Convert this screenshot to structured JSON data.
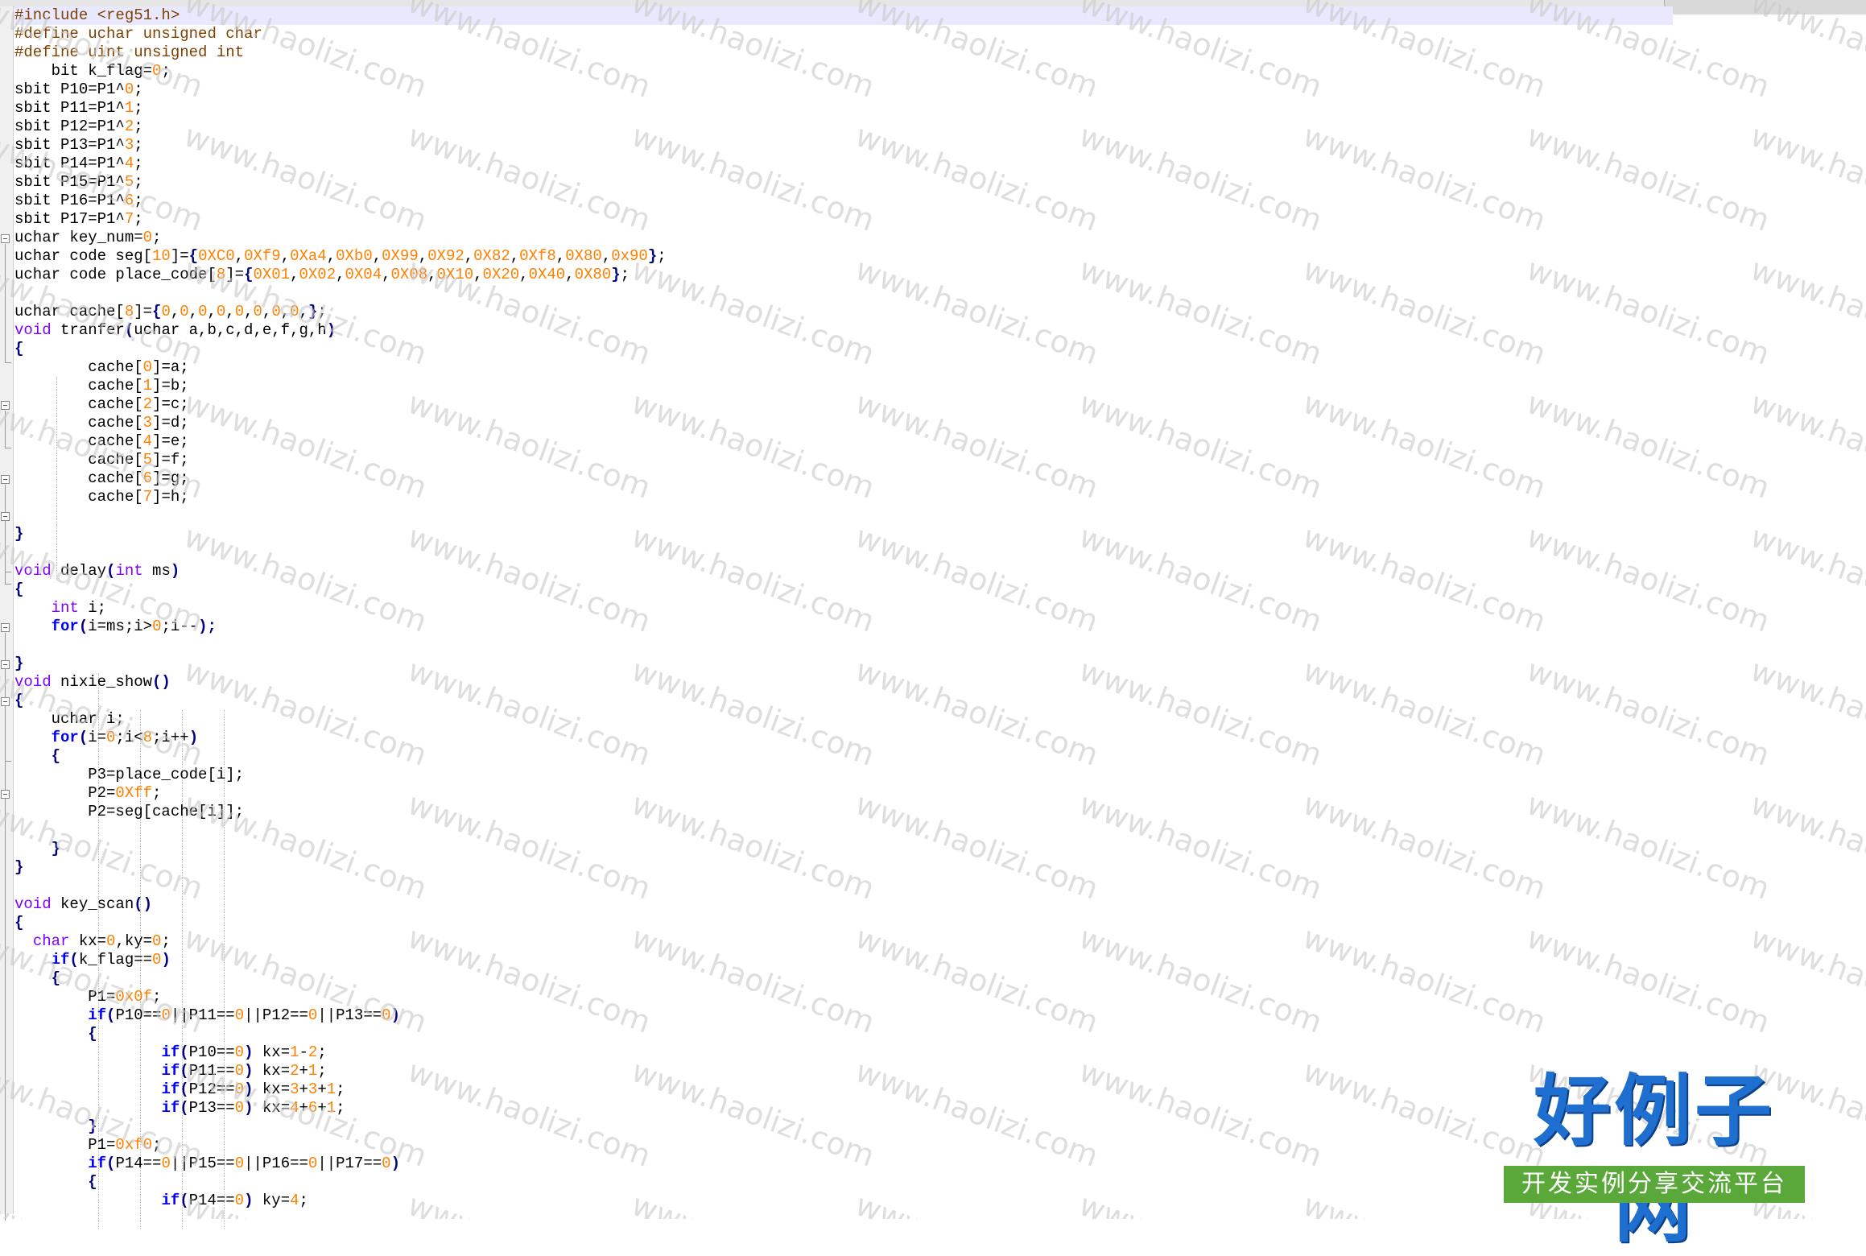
{
  "editor": {
    "lines": [
      [
        {
          "t": "#include <reg51.h>",
          "c": "pre"
        }
      ],
      [
        {
          "t": "#define uchar unsigned char",
          "c": "pre"
        }
      ],
      [
        {
          "t": "#define uint unsigned int",
          "c": "pre"
        }
      ],
      [
        {
          "t": "    bit k_flag="
        },
        {
          "t": "0",
          "c": "num"
        },
        {
          "t": ";"
        }
      ],
      [
        {
          "t": "sbit P10=P1^"
        },
        {
          "t": "0",
          "c": "num"
        },
        {
          "t": ";"
        }
      ],
      [
        {
          "t": "sbit P11=P1^"
        },
        {
          "t": "1",
          "c": "num"
        },
        {
          "t": ";"
        }
      ],
      [
        {
          "t": "sbit P12=P1^"
        },
        {
          "t": "2",
          "c": "num"
        },
        {
          "t": ";"
        }
      ],
      [
        {
          "t": "sbit P13=P1^"
        },
        {
          "t": "3",
          "c": "num"
        },
        {
          "t": ";"
        }
      ],
      [
        {
          "t": "sbit P14=P1^"
        },
        {
          "t": "4",
          "c": "num"
        },
        {
          "t": ";"
        }
      ],
      [
        {
          "t": "sbit P15=P1^"
        },
        {
          "t": "5",
          "c": "num"
        },
        {
          "t": ";"
        }
      ],
      [
        {
          "t": "sbit P16=P1^"
        },
        {
          "t": "6",
          "c": "num"
        },
        {
          "t": ";"
        }
      ],
      [
        {
          "t": "sbit P17=P1^"
        },
        {
          "t": "7",
          "c": "num"
        },
        {
          "t": ";"
        }
      ],
      [
        {
          "t": "uchar key_num="
        },
        {
          "t": "0",
          "c": "num"
        },
        {
          "t": ";"
        }
      ],
      [
        {
          "t": "uchar code seg["
        },
        {
          "t": "10",
          "c": "num"
        },
        {
          "t": "]="
        },
        {
          "t": "{",
          "c": "op"
        },
        {
          "t": "0XC0",
          "c": "num"
        },
        {
          "t": ","
        },
        {
          "t": "0Xf9",
          "c": "num"
        },
        {
          "t": ","
        },
        {
          "t": "0Xa4",
          "c": "num"
        },
        {
          "t": ","
        },
        {
          "t": "0Xb0",
          "c": "num"
        },
        {
          "t": ","
        },
        {
          "t": "0X99",
          "c": "num"
        },
        {
          "t": ","
        },
        {
          "t": "0X92",
          "c": "num"
        },
        {
          "t": ","
        },
        {
          "t": "0X82",
          "c": "num"
        },
        {
          "t": ","
        },
        {
          "t": "0Xf8",
          "c": "num"
        },
        {
          "t": ","
        },
        {
          "t": "0X80",
          "c": "num"
        },
        {
          "t": ","
        },
        {
          "t": "0x90",
          "c": "num"
        },
        {
          "t": "}",
          "c": "op"
        },
        {
          "t": ";"
        }
      ],
      [
        {
          "t": "uchar code place_code["
        },
        {
          "t": "8",
          "c": "num"
        },
        {
          "t": "]="
        },
        {
          "t": "{",
          "c": "op"
        },
        {
          "t": "0X01",
          "c": "num"
        },
        {
          "t": ","
        },
        {
          "t": "0X02",
          "c": "num"
        },
        {
          "t": ","
        },
        {
          "t": "0X04",
          "c": "num"
        },
        {
          "t": ","
        },
        {
          "t": "0X08",
          "c": "num"
        },
        {
          "t": ","
        },
        {
          "t": "0X10",
          "c": "num"
        },
        {
          "t": ","
        },
        {
          "t": "0X20",
          "c": "num"
        },
        {
          "t": ","
        },
        {
          "t": "0X40",
          "c": "num"
        },
        {
          "t": ","
        },
        {
          "t": "0X80",
          "c": "num"
        },
        {
          "t": "}",
          "c": "op"
        },
        {
          "t": ";"
        }
      ],
      [],
      [
        {
          "t": "uchar cache["
        },
        {
          "t": "8",
          "c": "num"
        },
        {
          "t": "]="
        },
        {
          "t": "{",
          "c": "op"
        },
        {
          "t": "0",
          "c": "num"
        },
        {
          "t": ","
        },
        {
          "t": "0",
          "c": "num"
        },
        {
          "t": ","
        },
        {
          "t": "0",
          "c": "num"
        },
        {
          "t": ","
        },
        {
          "t": "0",
          "c": "num"
        },
        {
          "t": ","
        },
        {
          "t": "0",
          "c": "num"
        },
        {
          "t": ","
        },
        {
          "t": "0",
          "c": "num"
        },
        {
          "t": ","
        },
        {
          "t": "0",
          "c": "num"
        },
        {
          "t": ","
        },
        {
          "t": "0",
          "c": "num"
        },
        {
          "t": ","
        },
        {
          "t": "}",
          "c": "op"
        },
        {
          "t": ";"
        }
      ],
      [
        {
          "t": "void",
          "c": "kw"
        },
        {
          "t": " tranfer"
        },
        {
          "t": "(",
          "c": "op"
        },
        {
          "t": "uchar a,b,c,d,e,f,g,h"
        },
        {
          "t": ")",
          "c": "op"
        }
      ],
      [
        {
          "t": "{",
          "c": "op"
        }
      ],
      [
        {
          "t": "        cache["
        },
        {
          "t": "0",
          "c": "num"
        },
        {
          "t": "]=a;"
        }
      ],
      [
        {
          "t": "        cache["
        },
        {
          "t": "1",
          "c": "num"
        },
        {
          "t": "]=b;"
        }
      ],
      [
        {
          "t": "        cache["
        },
        {
          "t": "2",
          "c": "num"
        },
        {
          "t": "]=c;"
        }
      ],
      [
        {
          "t": "        cache["
        },
        {
          "t": "3",
          "c": "num"
        },
        {
          "t": "]=d;"
        }
      ],
      [
        {
          "t": "        cache["
        },
        {
          "t": "4",
          "c": "num"
        },
        {
          "t": "]=e;"
        }
      ],
      [
        {
          "t": "        cache["
        },
        {
          "t": "5",
          "c": "num"
        },
        {
          "t": "]=f;"
        }
      ],
      [
        {
          "t": "        cache["
        },
        {
          "t": "6",
          "c": "num"
        },
        {
          "t": "]=g;"
        }
      ],
      [
        {
          "t": "        cache["
        },
        {
          "t": "7",
          "c": "num"
        },
        {
          "t": "]=h;"
        }
      ],
      [],
      [
        {
          "t": "}",
          "c": "op"
        }
      ],
      [],
      [
        {
          "t": "void",
          "c": "kw"
        },
        {
          "t": " delay"
        },
        {
          "t": "(",
          "c": "op"
        },
        {
          "t": "int",
          "c": "kw"
        },
        {
          "t": " ms"
        },
        {
          "t": ")",
          "c": "op"
        }
      ],
      [
        {
          "t": "{",
          "c": "op"
        }
      ],
      [
        {
          "t": "    "
        },
        {
          "t": "int",
          "c": "kw"
        },
        {
          "t": " i;"
        }
      ],
      [
        {
          "t": "    "
        },
        {
          "t": "for",
          "c": "kwb"
        },
        {
          "t": "(",
          "c": "op"
        },
        {
          "t": "i=ms;i>"
        },
        {
          "t": "0",
          "c": "num"
        },
        {
          "t": ";i--"
        },
        {
          "t": ");",
          "c": "op"
        }
      ],
      [],
      [
        {
          "t": "}",
          "c": "op"
        }
      ],
      [
        {
          "t": "void",
          "c": "kw"
        },
        {
          "t": " nixie_show"
        },
        {
          "t": "()",
          "c": "op"
        }
      ],
      [
        {
          "t": "{",
          "c": "op"
        }
      ],
      [
        {
          "t": "    uchar i;"
        }
      ],
      [
        {
          "t": "    "
        },
        {
          "t": "for",
          "c": "kwb"
        },
        {
          "t": "(",
          "c": "op"
        },
        {
          "t": "i="
        },
        {
          "t": "0",
          "c": "num"
        },
        {
          "t": ";i<"
        },
        {
          "t": "8",
          "c": "num"
        },
        {
          "t": ";i++"
        },
        {
          "t": ")",
          "c": "op"
        }
      ],
      [
        {
          "t": "    "
        },
        {
          "t": "{",
          "c": "op"
        }
      ],
      [
        {
          "t": "        P3=place_code[i];"
        }
      ],
      [
        {
          "t": "        P2="
        },
        {
          "t": "0Xff",
          "c": "num"
        },
        {
          "t": ";"
        }
      ],
      [
        {
          "t": "        P2=seg[cache[i]];"
        }
      ],
      [],
      [
        {
          "t": "    "
        },
        {
          "t": "}",
          "c": "op"
        }
      ],
      [
        {
          "t": "}",
          "c": "op"
        }
      ],
      [],
      [
        {
          "t": "void",
          "c": "kw"
        },
        {
          "t": " key_scan"
        },
        {
          "t": "()",
          "c": "op"
        }
      ],
      [
        {
          "t": "{",
          "c": "op"
        }
      ],
      [
        {
          "t": "  "
        },
        {
          "t": "char",
          "c": "kw"
        },
        {
          "t": " kx="
        },
        {
          "t": "0",
          "c": "num"
        },
        {
          "t": ",ky="
        },
        {
          "t": "0",
          "c": "num"
        },
        {
          "t": ";"
        }
      ],
      [
        {
          "t": "    "
        },
        {
          "t": "if",
          "c": "kwb"
        },
        {
          "t": "(",
          "c": "op"
        },
        {
          "t": "k_flag=="
        },
        {
          "t": "0",
          "c": "num"
        },
        {
          "t": ")",
          "c": "op"
        }
      ],
      [
        {
          "t": "    "
        },
        {
          "t": "{",
          "c": "op"
        }
      ],
      [
        {
          "t": "        P1="
        },
        {
          "t": "0x0f",
          "c": "num"
        },
        {
          "t": ";"
        }
      ],
      [
        {
          "t": "        "
        },
        {
          "t": "if",
          "c": "kwb"
        },
        {
          "t": "(",
          "c": "op"
        },
        {
          "t": "P10=="
        },
        {
          "t": "0",
          "c": "num"
        },
        {
          "t": "||P11=="
        },
        {
          "t": "0",
          "c": "num"
        },
        {
          "t": "||P12=="
        },
        {
          "t": "0",
          "c": "num"
        },
        {
          "t": "||P13=="
        },
        {
          "t": "0",
          "c": "num"
        },
        {
          "t": ")",
          "c": "op"
        }
      ],
      [
        {
          "t": "        "
        },
        {
          "t": "{",
          "c": "op"
        }
      ],
      [
        {
          "t": "                "
        },
        {
          "t": "if",
          "c": "kwb"
        },
        {
          "t": "(",
          "c": "op"
        },
        {
          "t": "P10=="
        },
        {
          "t": "0",
          "c": "num"
        },
        {
          "t": ")",
          "c": "op"
        },
        {
          "t": " kx="
        },
        {
          "t": "1",
          "c": "num"
        },
        {
          "t": "-"
        },
        {
          "t": "2",
          "c": "num"
        },
        {
          "t": ";"
        }
      ],
      [
        {
          "t": "                "
        },
        {
          "t": "if",
          "c": "kwb"
        },
        {
          "t": "(",
          "c": "op"
        },
        {
          "t": "P11=="
        },
        {
          "t": "0",
          "c": "num"
        },
        {
          "t": ")",
          "c": "op"
        },
        {
          "t": " kx="
        },
        {
          "t": "2",
          "c": "num"
        },
        {
          "t": "+"
        },
        {
          "t": "1",
          "c": "num"
        },
        {
          "t": ";"
        }
      ],
      [
        {
          "t": "                "
        },
        {
          "t": "if",
          "c": "kwb"
        },
        {
          "t": "(",
          "c": "op"
        },
        {
          "t": "P12=="
        },
        {
          "t": "0",
          "c": "num"
        },
        {
          "t": ")",
          "c": "op"
        },
        {
          "t": " kx="
        },
        {
          "t": "3",
          "c": "num"
        },
        {
          "t": "+"
        },
        {
          "t": "3",
          "c": "num"
        },
        {
          "t": "+"
        },
        {
          "t": "1",
          "c": "num"
        },
        {
          "t": ";"
        }
      ],
      [
        {
          "t": "                "
        },
        {
          "t": "if",
          "c": "kwb"
        },
        {
          "t": "(",
          "c": "op"
        },
        {
          "t": "P13=="
        },
        {
          "t": "0",
          "c": "num"
        },
        {
          "t": ")",
          "c": "op"
        },
        {
          "t": " kx="
        },
        {
          "t": "4",
          "c": "num"
        },
        {
          "t": "+"
        },
        {
          "t": "6",
          "c": "num"
        },
        {
          "t": "+"
        },
        {
          "t": "1",
          "c": "num"
        },
        {
          "t": ";"
        }
      ],
      [
        {
          "t": "        "
        },
        {
          "t": "}",
          "c": "op"
        }
      ],
      [
        {
          "t": "        P1="
        },
        {
          "t": "0xf0",
          "c": "num"
        },
        {
          "t": ";"
        }
      ],
      [
        {
          "t": "        "
        },
        {
          "t": "if",
          "c": "kwb"
        },
        {
          "t": "(",
          "c": "op"
        },
        {
          "t": "P14=="
        },
        {
          "t": "0",
          "c": "num"
        },
        {
          "t": "||P15=="
        },
        {
          "t": "0",
          "c": "num"
        },
        {
          "t": "||P16=="
        },
        {
          "t": "0",
          "c": "num"
        },
        {
          "t": "||P17=="
        },
        {
          "t": "0",
          "c": "num"
        },
        {
          "t": ")",
          "c": "op"
        }
      ],
      [
        {
          "t": "        "
        },
        {
          "t": "{",
          "c": "op"
        }
      ],
      [
        {
          "t": "                "
        },
        {
          "t": "if",
          "c": "kwb"
        },
        {
          "t": "(",
          "c": "op"
        },
        {
          "t": "P14=="
        },
        {
          "t": "0",
          "c": "num"
        },
        {
          "t": ")",
          "c": "op"
        },
        {
          "t": " ky="
        },
        {
          "t": "4",
          "c": "num"
        },
        {
          "t": ";"
        }
      ]
    ]
  },
  "watermark": {
    "text": "www.haolizi.com"
  },
  "logo": {
    "title": "好例子网",
    "subtitle": "开发实例分享交流平台"
  }
}
